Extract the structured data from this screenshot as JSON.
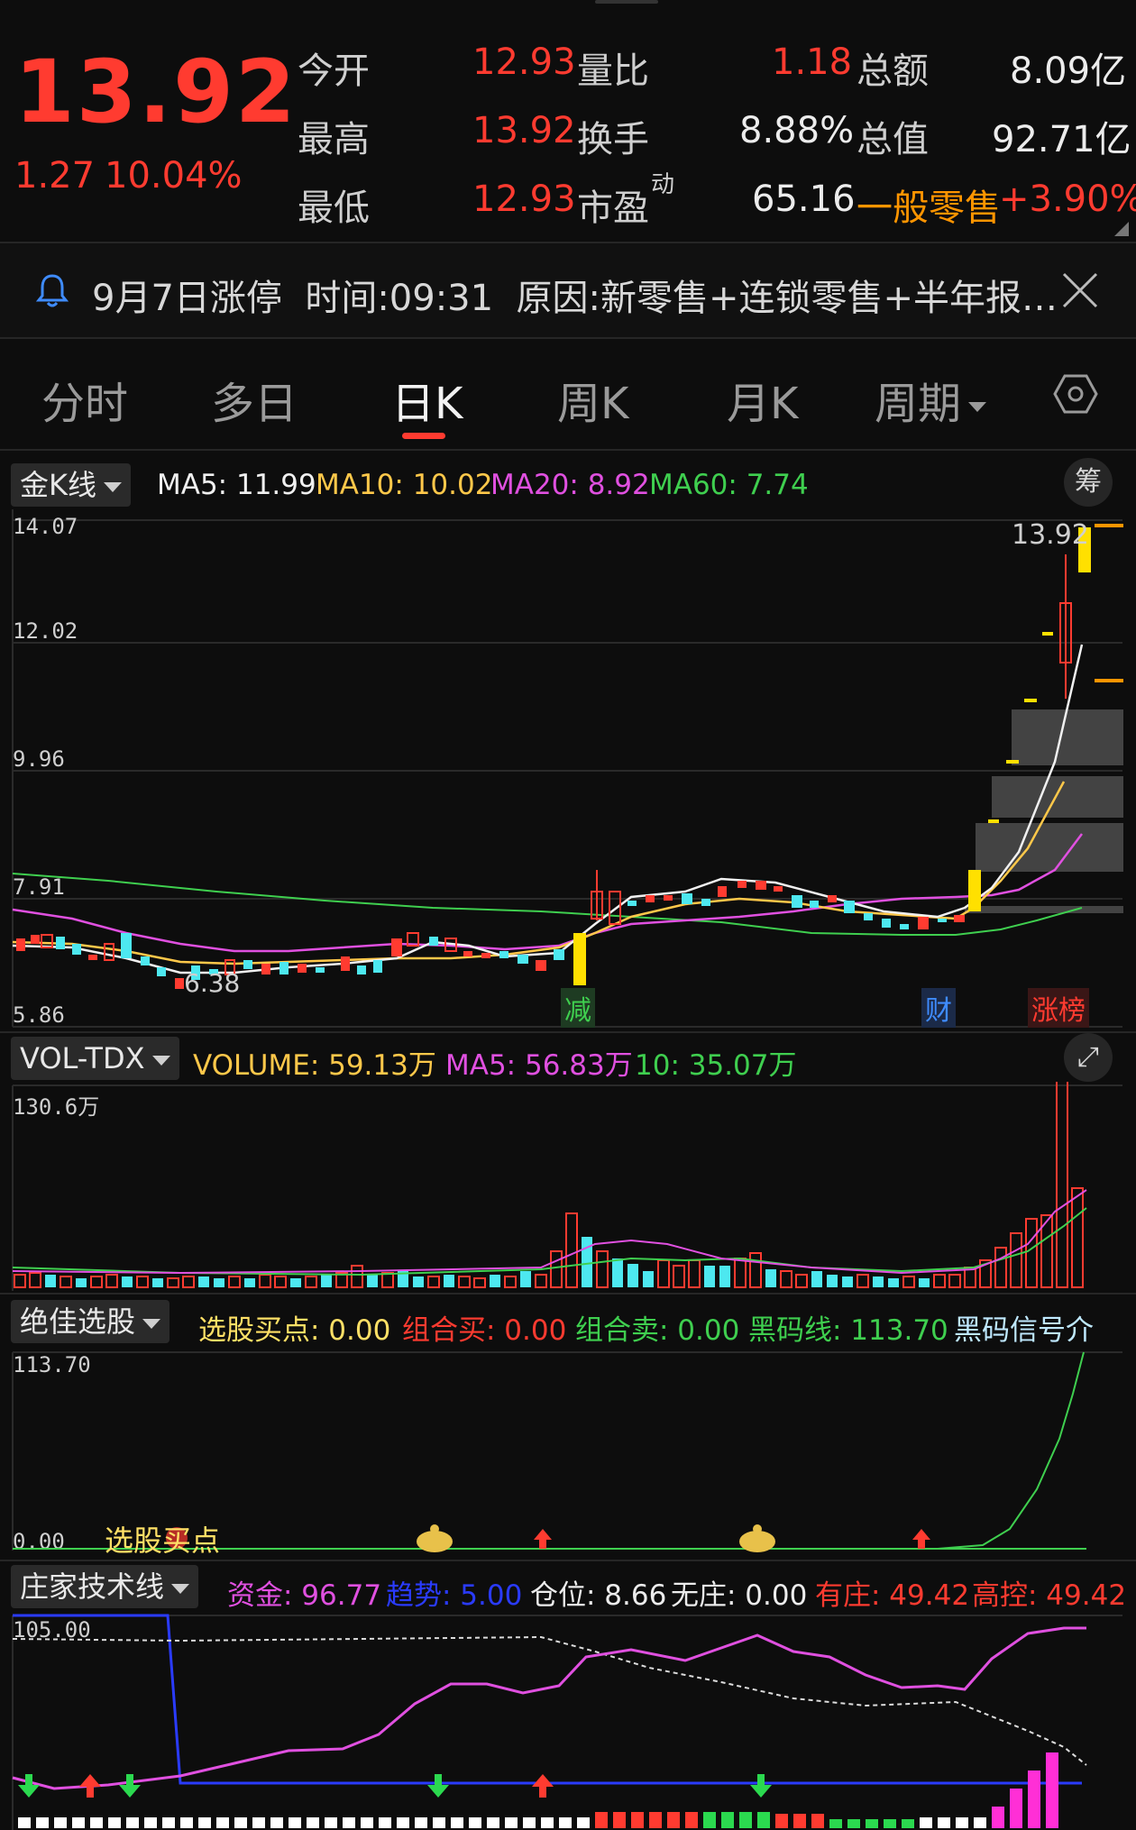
{
  "quote": {
    "price": "13.92",
    "change": "1.27",
    "change_pct": "10.04%",
    "rows": [
      {
        "l1": "今开",
        "v1": "12.93",
        "l2": "量比",
        "v2": "1.18",
        "l3": "总额",
        "v3": "8.09亿"
      },
      {
        "l1": "最高",
        "v1": "13.92",
        "l2": "换手",
        "v2": "8.88%",
        "l3": "总值",
        "v3": "92.71亿"
      },
      {
        "l1": "最低",
        "v1": "12.93",
        "l2": "市盈",
        "v2": "65.16",
        "l3": "一般零售",
        "v3": "+3.90%"
      }
    ],
    "pe_superscript": "动"
  },
  "notice": {
    "text": "9月7日涨停  时间:09:31  原因:新零售+连锁零售+半年报…"
  },
  "tabs": [
    "分时",
    "多日",
    "日K",
    "周K",
    "月K",
    "周期"
  ],
  "active_tab": "日K",
  "kline": {
    "selector": "金K线",
    "ma5": "MA5: 11.99",
    "ma10": "MA10: 10.02",
    "ma20": "MA20: 8.92",
    "ma60": "MA60: 7.74",
    "chip_btn": "筹",
    "y_labels": [
      "14.07",
      "12.02",
      "9.96",
      "7.91",
      "5.86"
    ],
    "high_label": "13.92",
    "low_label": "6.38",
    "markers": [
      "减",
      "财",
      "涨榜"
    ]
  },
  "volume": {
    "selector": "VOL-TDX",
    "volume": "VOLUME: 59.13万",
    "ma5": "MA5: 56.83万",
    "ma10": "10: 35.07万",
    "y_max": "130.6万"
  },
  "stock_pick": {
    "selector": "绝佳选股",
    "buy": "选股买点: 0.00",
    "combo_buy": "组合买: 0.00",
    "combo_sell": "组合卖: 0.00",
    "black_code": "黑码线: 113.70",
    "black_signal": "黑码信号介",
    "y_max": "113.70",
    "y_min": "0.00",
    "label": "选股买点"
  },
  "dealer": {
    "selector": "庄家技术线",
    "fund": "资金: 96.77",
    "trend": "趋势: 5.00",
    "position": "仓位: 8.66",
    "no_dealer": "无庄: 0.00",
    "has_dealer": "有庄: 49.42",
    "high_control": "高控: 49.42",
    "y_max": "105.00"
  },
  "colors": {
    "up": "#ff3b30",
    "down": "#4de8f0",
    "limit_up": "#ffe000",
    "ma5": "#f0f0f0",
    "ma10": "#ffc84a",
    "ma20": "#e050e0",
    "ma60": "#3fcf4f"
  }
}
